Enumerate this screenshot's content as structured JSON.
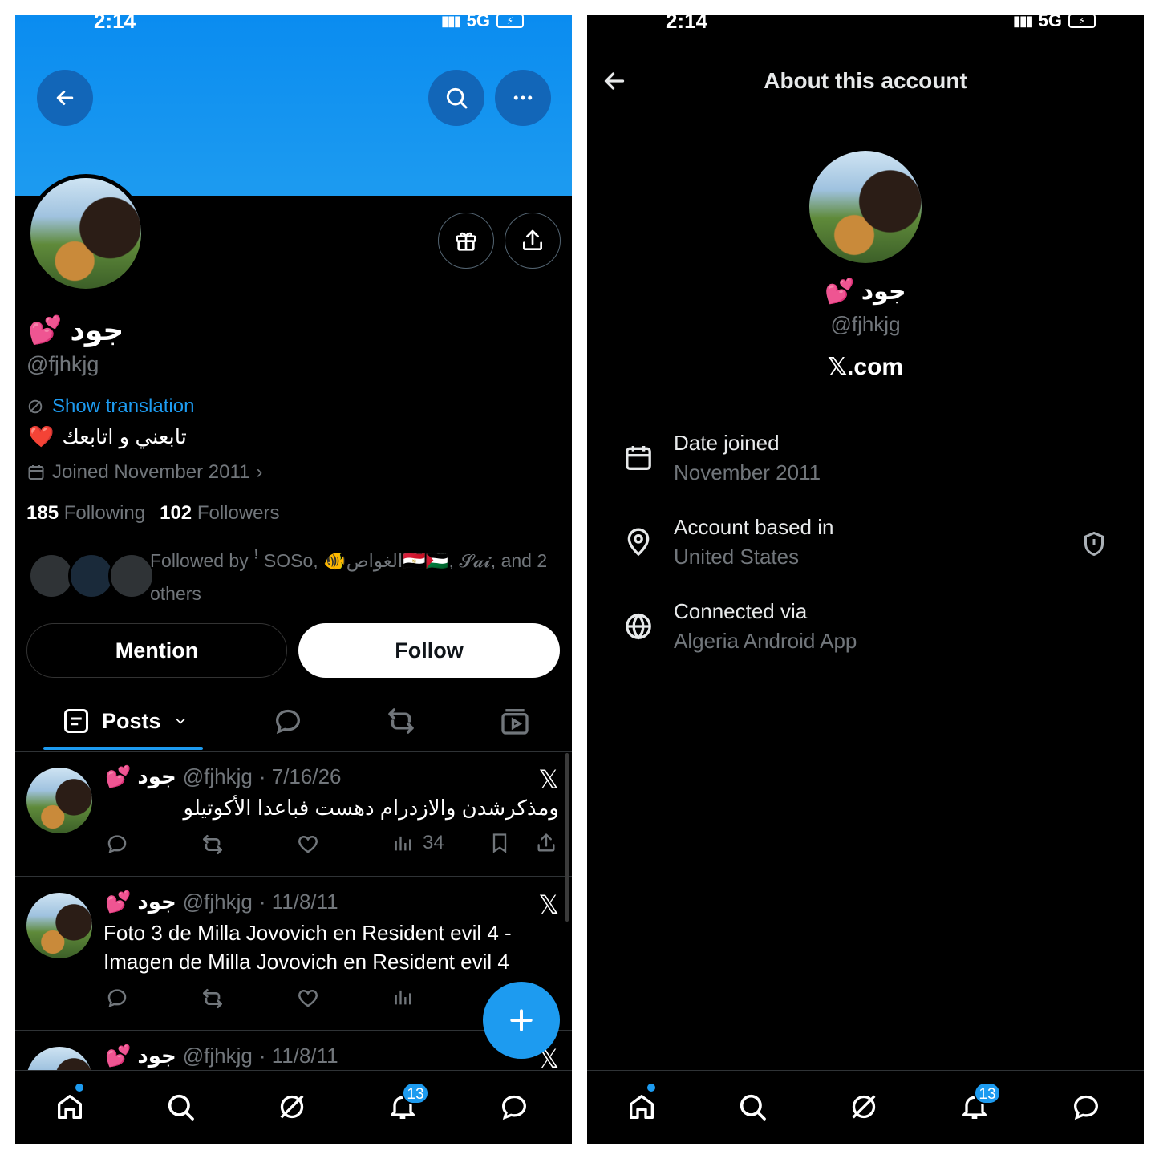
{
  "status_bar": {
    "time": "2:14",
    "network": "5G"
  },
  "left": {
    "profile": {
      "name": "جود",
      "name_emoji": "💕",
      "handle": "@fjhkjg",
      "show_translation": "Show translation",
      "bio": "تابعني و اتابعك",
      "bio_emoji": "❤️",
      "joined": "Joined November 2011",
      "following_count": "185",
      "following_label": "Following",
      "followers_count": "102",
      "followers_label": "Followers",
      "followed_by": "Followed by ꜝ SOSo, 🐠الغواص🇪🇬🇵🇸, 𝓢𝓪𝓲, and 2 others"
    },
    "buttons": {
      "mention": "Mention",
      "follow": "Follow"
    },
    "tabs": {
      "posts": "Posts"
    },
    "posts": [
      {
        "name": "جود",
        "emoji": "💕",
        "handle": "@fjhkjg",
        "date": "· 7/16/26",
        "text": "ومذكرشدن والازدرام دهست فباعدا الأكوتيلو",
        "views": "34"
      },
      {
        "name": "جود",
        "emoji": "💕",
        "handle": "@fjhkjg",
        "date": "· 11/8/11",
        "text": "Foto 3 de Milla Jovovich en Resident evil 4 - Imagen de Milla Jovovich en Resident evil 4",
        "views": ""
      },
      {
        "name": "جود",
        "emoji": "💕",
        "handle": "@fjhkjg",
        "date": "· 11/8/11",
        "text": "",
        "views": ""
      }
    ],
    "notifications_badge": "13"
  },
  "right": {
    "title": "About this account",
    "name": "جود",
    "name_emoji": "💕",
    "handle": "@fjhkjg",
    "site": "𝕏.com",
    "rows": [
      {
        "label": "Date joined",
        "value": "November 2011",
        "icon": "calendar-icon"
      },
      {
        "label": "Account based in",
        "value": "United States",
        "icon": "location-pin-icon"
      },
      {
        "label": "Connected via",
        "value": "Algeria Android App",
        "icon": "globe-icon"
      }
    ],
    "notifications_badge": "13"
  },
  "colors": {
    "accent": "#1d9bf0",
    "background": "#000000",
    "secondary_text": "#71767b",
    "banner": "#1d9bf0"
  }
}
